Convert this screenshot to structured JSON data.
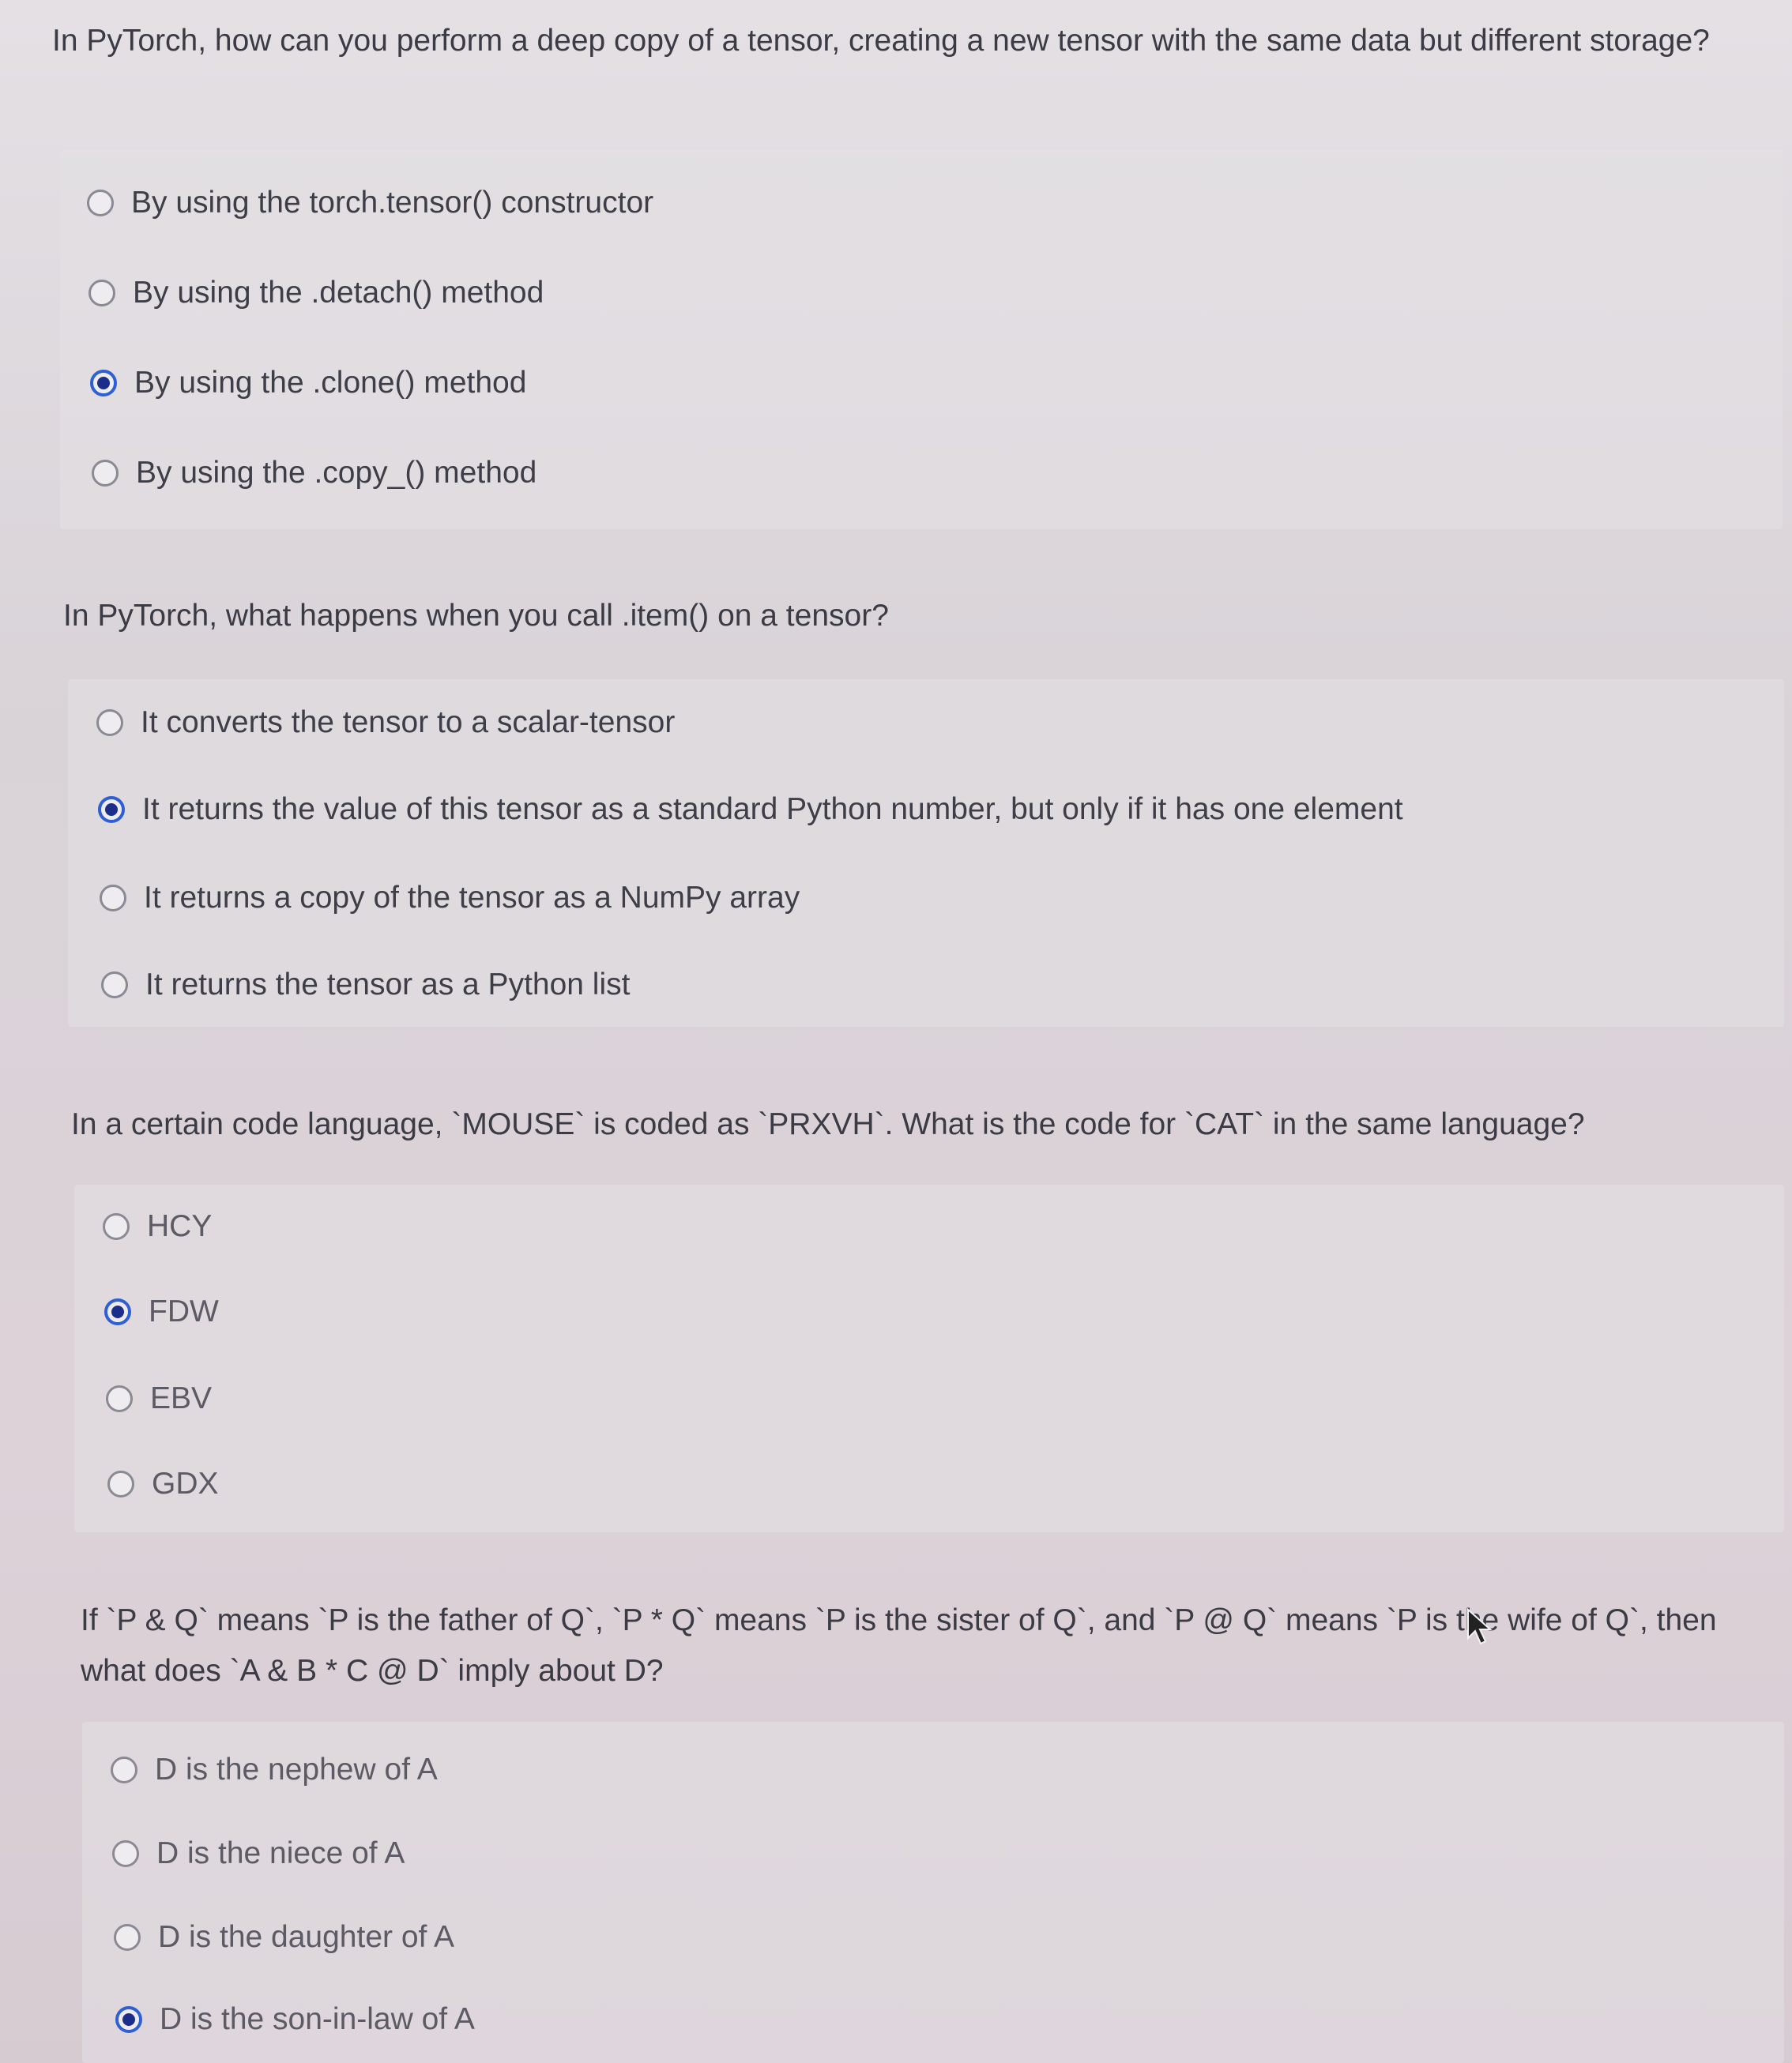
{
  "questions": [
    {
      "text": "In PyTorch, how can you perform a deep copy of a tensor, creating a new tensor with the same data but different storage?",
      "options": [
        {
          "label": "By using the torch.tensor() constructor",
          "selected": false
        },
        {
          "label": "By using the .detach() method",
          "selected": false
        },
        {
          "label": "By using the .clone() method",
          "selected": true
        },
        {
          "label": "By using the .copy_() method",
          "selected": false
        }
      ]
    },
    {
      "text": "In PyTorch, what happens when you call .item() on a tensor?",
      "options": [
        {
          "label": "It converts the tensor to a scalar-tensor",
          "selected": false
        },
        {
          "label": "It returns the value of this tensor as a standard Python number, but only if it has one element",
          "selected": true
        },
        {
          "label": "It returns a copy of the tensor as a NumPy array",
          "selected": false
        },
        {
          "label": "It returns the tensor as a Python list",
          "selected": false
        }
      ]
    },
    {
      "text": "In a certain code language, `MOUSE` is coded as `PRXVH`. What is the code for `CAT` in the same language?",
      "options": [
        {
          "label": "HCY",
          "selected": false
        },
        {
          "label": "FDW",
          "selected": true
        },
        {
          "label": "EBV",
          "selected": false
        },
        {
          "label": "GDX",
          "selected": false
        }
      ]
    },
    {
      "text": "If `P & Q` means `P is the father of Q`, `P * Q` means `P is the sister of Q`, and `P @ Q` means `P is the wife of Q`, then what does `A & B * C @ D` imply about D?",
      "options": [
        {
          "label": "D is the nephew of A",
          "selected": false
        },
        {
          "label": "D is the niece of A",
          "selected": false
        },
        {
          "label": "D is the daughter of A",
          "selected": false
        },
        {
          "label": "D is the son-in-law of A",
          "selected": true
        }
      ]
    }
  ],
  "colors": {
    "radio_checked": "#2f5fd4",
    "radio_dot": "#1b2f8a",
    "text": "#3b3b45"
  }
}
